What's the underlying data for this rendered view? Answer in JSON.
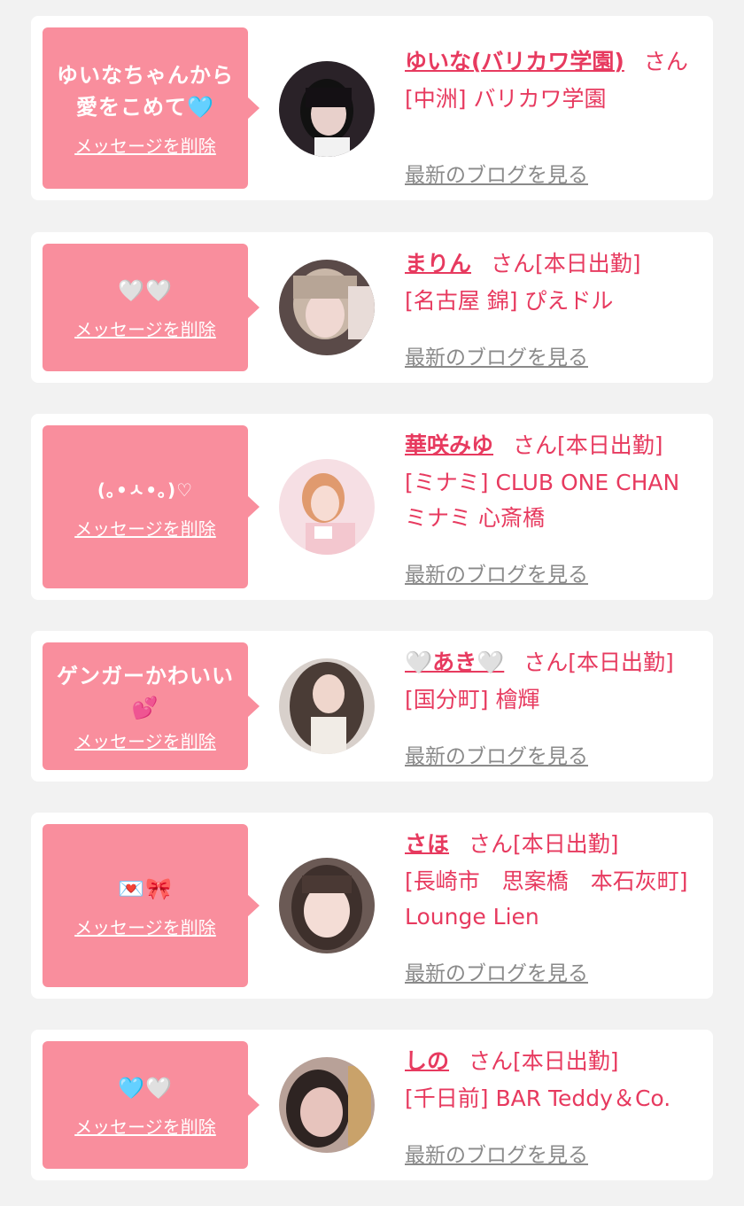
{
  "common": {
    "delete_label": "メッセージを削除",
    "blog_label": "最新のブログを見る",
    "san": "さん",
    "accent_color": "#e73a5f",
    "bubble_color": "#f98e9d"
  },
  "cards": [
    {
      "message": "ゆいなちゃんから\n愛をこめて🩵",
      "name": "ゆいな(バリカワ学園)",
      "shift": "",
      "shop": "[中洲] バリカワ学園"
    },
    {
      "message": "🤍🤍",
      "name": "まりん",
      "shift": "[本日出勤]",
      "shop": "[名古屋 錦] ぴえドル"
    },
    {
      "message": "(｡•ㅅ•｡)♡",
      "name": "華咲みゆ",
      "shift": "[本日出勤]",
      "shop": "[ミナミ] CLUB ONE CHAN ミナミ 心斎橋"
    },
    {
      "message": "ゲンガーかわいい\n💕",
      "name": "🤍あき🤍",
      "shift": "[本日出勤]",
      "shop": "[国分町] 檜輝"
    },
    {
      "message": "💌🎀",
      "name": "さほ",
      "shift": "[本日出勤]",
      "shop": "[長崎市　思案橋　本石灰町] Lounge Lien"
    },
    {
      "message": "🩵🤍",
      "name": "しの",
      "shift": "[本日出勤]",
      "shop": "[千日前] BAR Teddy＆Co."
    }
  ]
}
